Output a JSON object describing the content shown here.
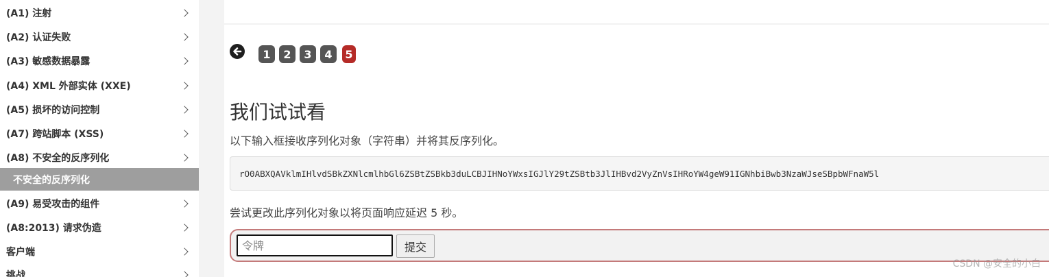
{
  "sidebar": {
    "items": [
      {
        "label": "(A1) 注射"
      },
      {
        "label": "(A2) 认证失败"
      },
      {
        "label": "(A3) 敏感数据暴露"
      },
      {
        "label": "(A4) XML 外部实体 (XXE)"
      },
      {
        "label": "(A5) 损坏的访问控制"
      },
      {
        "label": "(A7) 跨站脚本 (XSS)"
      },
      {
        "label": "(A8) 不安全的反序列化"
      },
      {
        "label": "(A9) 易受攻击的组件"
      },
      {
        "label": "(A8:2013) 请求伪造"
      },
      {
        "label": "客户端"
      },
      {
        "label": "挑战"
      }
    ],
    "active_sub_item": "不安全的反序列化"
  },
  "pagination": {
    "pages": [
      "1",
      "2",
      "3",
      "4",
      "5"
    ],
    "current": "5"
  },
  "content": {
    "title": "我们试试看",
    "description": "以下输入框接收序列化对象（字符串）并将其反序列化。",
    "serialized_object": "rO0ABXQAVklmIHlvdSBkZXNlcmlhbGl6ZSBtZSBkb3duLCBJIHNoYWxsIGJlY29tZSBtb3JlIHBvd2VyZnVsIHRoYW4geW91IGNhbiBwb3NzaWJseSBpbWFnaW5l",
    "instruction": "尝试更改此序列化对象以将页面响应延迟 5 秒。"
  },
  "form": {
    "token_placeholder": "令牌",
    "token_value": "",
    "submit_label": "提交"
  },
  "watermark": "CSDN @安全的小白",
  "colors": {
    "active_page": "#b52b27",
    "page_button": "#555555",
    "active_sidebar": "#9e9e9e",
    "form_border": "#c47a7a"
  }
}
